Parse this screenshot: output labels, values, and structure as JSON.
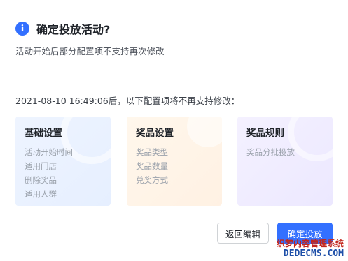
{
  "dialog": {
    "title": "确定投放活动?",
    "subtitle": "活动开始后部分配置项不支持再次修改",
    "notice": "2021-08-10 16:49:06后，以下配置项将不再支持修改：",
    "info_icon": "info-icon"
  },
  "cards": [
    {
      "title": "基础设置",
      "items": [
        "活动开始时间",
        "适用门店",
        "删除奖品",
        "适用人群"
      ]
    },
    {
      "title": "奖品设置",
      "items": [
        "奖品类型",
        "奖品数量",
        "兑奖方式"
      ]
    },
    {
      "title": "奖品规则",
      "items": [
        "奖品分批投放"
      ]
    }
  ],
  "buttons": {
    "cancel": "返回编辑",
    "confirm": "确定投放"
  },
  "watermark": {
    "line1": "织梦内容管理系统",
    "line2": "DEDECMS.COM"
  },
  "colors": {
    "accent": "#3370ff",
    "card1_bg": "#eef4ff",
    "card2_bg": "#fff7ec",
    "card3_bg": "#f4f1ff"
  }
}
